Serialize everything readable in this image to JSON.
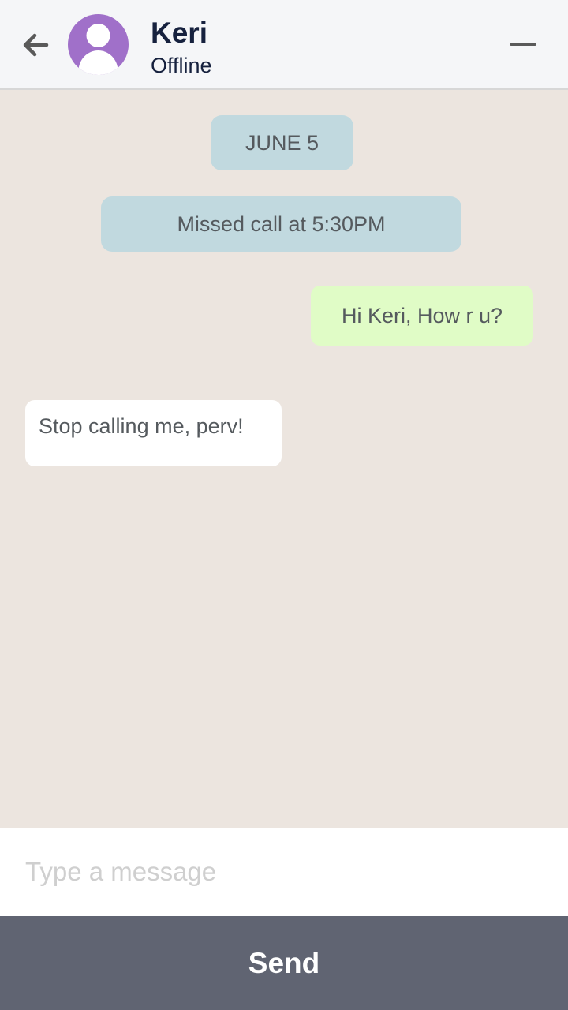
{
  "header": {
    "back_icon": "arrow-left-icon",
    "avatar_icon": "person-icon",
    "name": "Keri",
    "status": "Offline",
    "minimize_icon": "minus-icon"
  },
  "chat": {
    "date_label": "JUNE 5",
    "system_message": "Missed call at 5:30PM",
    "messages": [
      {
        "direction": "outgoing",
        "text": "Hi Keri, How r u?"
      },
      {
        "direction": "incoming",
        "text": "Stop calling me, perv!"
      }
    ]
  },
  "composer": {
    "placeholder": "Type a message",
    "value": "",
    "send_label": "Send"
  },
  "colors": {
    "chat_background": "#ece5df",
    "header_background": "#f5f6f8",
    "avatar": "#a070c9",
    "system_pill": "#c1d9df",
    "outgoing_bubble": "#e0fcc6",
    "incoming_bubble": "#ffffff",
    "send_button": "#606472"
  }
}
